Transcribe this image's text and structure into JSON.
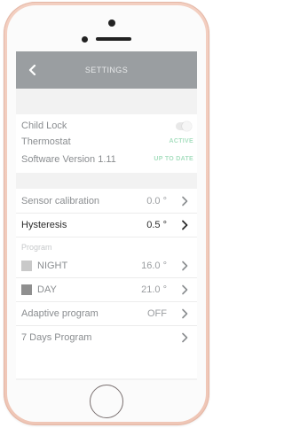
{
  "header": {
    "title": "SETTINGS"
  },
  "general": {
    "child_lock": {
      "label": "Child Lock",
      "enabled": false
    },
    "thermostat": {
      "label": "Thermostat",
      "status": "ACTIVE"
    },
    "software": {
      "label": "Software Version 1.11",
      "status": "UP TO DATE"
    }
  },
  "settings": {
    "sensor_calibration": {
      "label": "Sensor calibration",
      "value": "0.0 °"
    },
    "hysteresis": {
      "label": "Hysteresis",
      "value": "0.5 °"
    },
    "program_section": "Program",
    "night": {
      "label": "NIGHT",
      "value": "16.0 °",
      "color": "#c9c9c9"
    },
    "day": {
      "label": "DAY",
      "value": "21.0 °",
      "color": "#8f8f8f"
    },
    "adaptive_program": {
      "label": "Adaptive program",
      "value": "OFF"
    },
    "seven_days": {
      "label": "7 Days Program"
    }
  },
  "colors": {
    "header_bg": "#9a9ea1",
    "status_green": "#a8dfc0",
    "phone_body": "#f0c8b8"
  }
}
